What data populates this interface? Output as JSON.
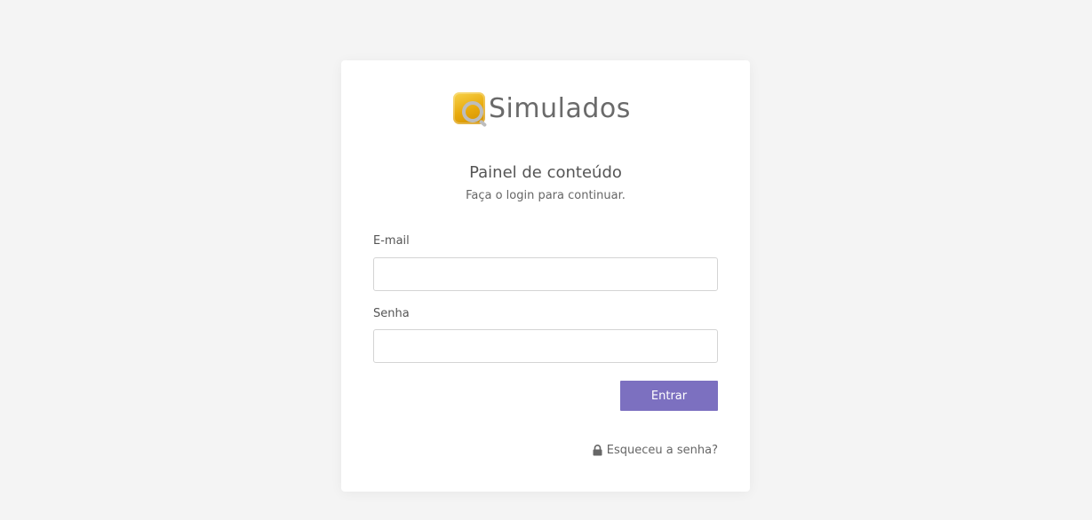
{
  "logo": {
    "text": "Simulados",
    "icon": "q-logo-icon"
  },
  "header": {
    "title": "Painel de conteúdo",
    "subtitle": "Faça o login para continuar."
  },
  "form": {
    "email_label": "E-mail",
    "email_value": "",
    "email_placeholder": "",
    "password_label": "Senha",
    "password_value": "",
    "password_placeholder": "",
    "submit_label": "Entrar"
  },
  "forgot": {
    "label": "Esqueceu a senha?",
    "icon": "lock-icon"
  },
  "colors": {
    "background": "#f4f4f4",
    "card": "#ffffff",
    "button": "#7c70c0",
    "logo_yellow": "#e8a90c"
  }
}
